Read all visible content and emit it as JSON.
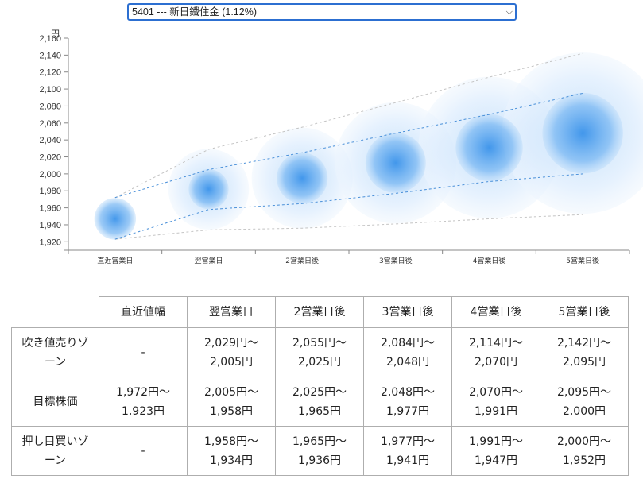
{
  "selector": {
    "selected": "5401 --- 新日鐵住金 (1.12%)"
  },
  "chart_data": {
    "type": "scatter",
    "unit_label": "円",
    "ylim": [
      1910,
      2160
    ],
    "y_ticks": [
      "1,920",
      "1,940",
      "1,960",
      "1,980",
      "2,000",
      "2,020",
      "2,040",
      "2,060",
      "2,080",
      "2,100",
      "2,120",
      "2,140",
      "2,160"
    ],
    "categories": [
      "直近営業日",
      "翌営業日",
      "2営業日後",
      "3営業日後",
      "4営業日後",
      "5営業日後"
    ],
    "centers": [
      1947,
      1982,
      1995,
      2013,
      2031,
      2048
    ],
    "upper_band": [
      1972,
      2005,
      2025,
      2048,
      2070,
      2095
    ],
    "lower_band": [
      1923,
      1958,
      1965,
      1977,
      1991,
      2000
    ],
    "outer_upper": [
      1972,
      2029,
      2055,
      2084,
      2114,
      2142
    ],
    "outer_lower": [
      1923,
      1934,
      1936,
      1941,
      1947,
      1952
    ],
    "colors": {
      "bubble_core": "#2f8ce8",
      "bubble_edge": "#ddeefe",
      "band_line": "#4a90d9",
      "outer_line": "#c4c4c4"
    }
  },
  "table": {
    "headers": [
      "直近値幅",
      "翌営業日",
      "2営業日後",
      "3営業日後",
      "4営業日後",
      "5営業日後"
    ],
    "rows": [
      {
        "label": [
          "吹き値売りゾ",
          "ーン"
        ],
        "cells": [
          [
            "-"
          ],
          [
            "2,029円〜",
            "2,005円"
          ],
          [
            "2,055円〜",
            "2,025円"
          ],
          [
            "2,084円〜",
            "2,048円"
          ],
          [
            "2,114円〜",
            "2,070円"
          ],
          [
            "2,142円〜",
            "2,095円"
          ]
        ]
      },
      {
        "label": [
          "目標株価"
        ],
        "cells": [
          [
            "1,972円〜",
            "1,923円"
          ],
          [
            "2,005円〜",
            "1,958円"
          ],
          [
            "2,025円〜",
            "1,965円"
          ],
          [
            "2,048円〜",
            "1,977円"
          ],
          [
            "2,070円〜",
            "1,991円"
          ],
          [
            "2,095円〜",
            "2,000円"
          ]
        ]
      },
      {
        "label": [
          "押し目買いゾ",
          "ーン"
        ],
        "cells": [
          [
            "-"
          ],
          [
            "1,958円〜",
            "1,934円"
          ],
          [
            "1,965円〜",
            "1,936円"
          ],
          [
            "1,977円〜",
            "1,941円"
          ],
          [
            "1,991円〜",
            "1,947円"
          ],
          [
            "2,000円〜",
            "1,952円"
          ]
        ]
      }
    ]
  }
}
